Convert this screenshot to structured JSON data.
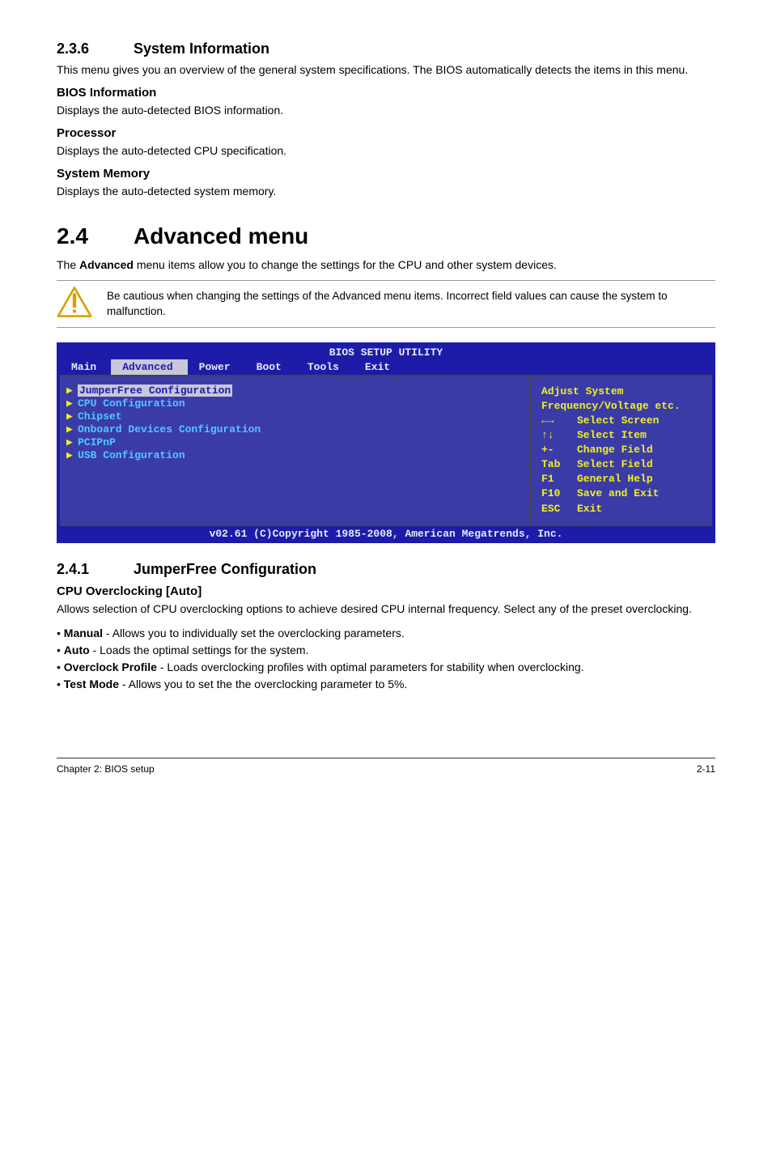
{
  "s236": {
    "num": "2.3.6",
    "title": "System Information",
    "intro": "This menu gives you an overview of the general system specifications. The BIOS automatically detects the items in this menu.",
    "bios": {
      "h": "BIOS Information",
      "t": "Displays the auto-detected BIOS information."
    },
    "proc": {
      "h": "Processor",
      "t": "Displays the auto-detected CPU specification."
    },
    "mem": {
      "h": "System Memory",
      "t": "Displays the auto-detected system memory."
    }
  },
  "s24": {
    "num": "2.4",
    "title": "Advanced menu",
    "intro_pre": "The ",
    "intro_bold": "Advanced",
    "intro_post": " menu items allow you to change the settings for the CPU and other system devices.",
    "note": "Be cautious when changing the settings of the Advanced menu items. Incorrect field values can cause the system to malfunction."
  },
  "bios_ui": {
    "title": "BIOS SETUP UTILITY",
    "tabs": [
      "Main",
      "Advanced",
      "Power",
      "Boot",
      "Tools",
      "Exit"
    ],
    "items": [
      "JumperFree Configuration",
      "CPU Configuration",
      "Chipset",
      "Onboard Devices Configuration",
      "PCIPnP",
      "USB Configuration"
    ],
    "help": "Adjust System Frequency/Voltage etc.",
    "keys": [
      {
        "k": "←→",
        "d": "Select Screen"
      },
      {
        "k": "↑↓",
        "d": "Select Item"
      },
      {
        "k": "+-",
        "d": "Change Field"
      },
      {
        "k": "Tab",
        "d": "Select Field"
      },
      {
        "k": "F1",
        "d": "General Help"
      },
      {
        "k": "F10",
        "d": "Save and Exit"
      },
      {
        "k": "ESC",
        "d": "Exit"
      }
    ],
    "footer": "v02.61 (C)Copyright 1985-2008, American Megatrends, Inc."
  },
  "s241": {
    "num": "2.4.1",
    "title": "JumperFree Configuration",
    "cpu_h": "CPU Overclocking [Auto]",
    "cpu_t": "Allows selection of CPU overclocking options to achieve desired CPU internal frequency. Select any of the preset overclocking.",
    "opts": [
      {
        "b": "Manual",
        "t": " - Allows you to individually set the overclocking parameters."
      },
      {
        "b": "Auto",
        "t": " - Loads the optimal settings for the system."
      },
      {
        "b": "Overclock Profile",
        "t": " - Loads overclocking profiles with optimal parameters for stability when overclocking."
      },
      {
        "b": "Test Mode",
        "t": " - Allows you to set the the overclocking parameter to 5%."
      }
    ]
  },
  "footer": {
    "left": "Chapter 2: BIOS setup",
    "right": "2-11"
  }
}
